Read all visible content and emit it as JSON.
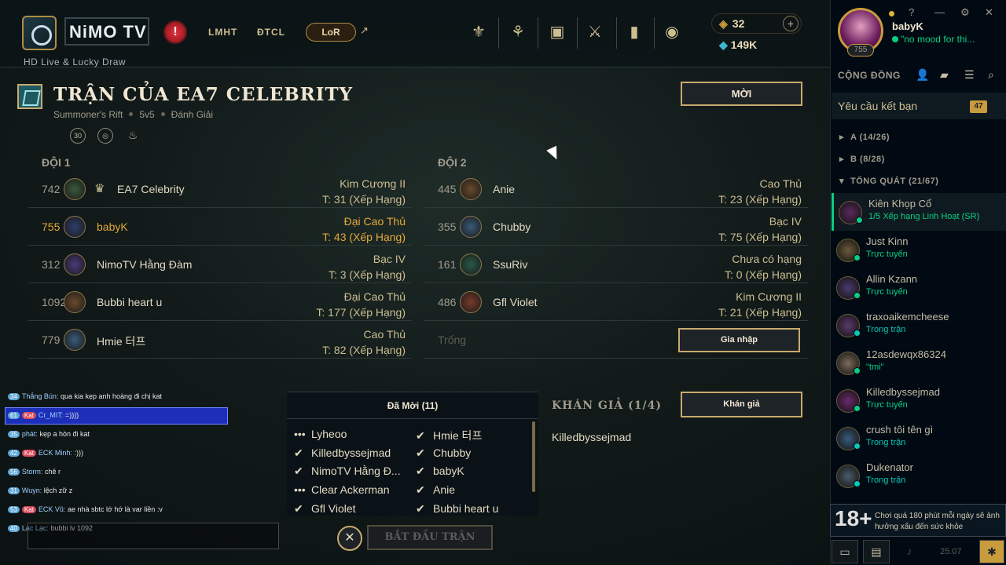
{
  "topbar": {
    "brand": "NiMO TV",
    "tagline": "HD Live & Lucky Draw",
    "nav": [
      "LMHT",
      "ĐTCL"
    ],
    "lor": "LoR",
    "rp": "32",
    "blue_essence": "149K",
    "icons": [
      "tft-icon",
      "loot-icon",
      "collection-icon",
      "clash-icon",
      "quests-icon",
      "store-icon"
    ]
  },
  "lobby": {
    "title": "TRẬN CỦA EA7 CELEBRITY",
    "map": "Summoner's Rift",
    "size": "5v5",
    "mode": "Đánh Giải",
    "mode_icon_label": "30",
    "invite_btn": "MỜI",
    "team1_title": "ĐỘI 1",
    "team2_title": "ĐỘI 2",
    "team1": [
      {
        "level": "742",
        "name": "EA7 Celebrity",
        "rank": "Kim Cương II",
        "tier": "T: 31 (Xếp Hạng)",
        "owner": true
      },
      {
        "level": "755",
        "name": "babyK",
        "rank": "Đại Cao Thủ",
        "tier": "T: 43 (Xếp Hạng)",
        "me": true
      },
      {
        "level": "312",
        "name": "NimoTV Hằng Đàm",
        "rank": "Bạc IV",
        "tier": "T: 3 (Xếp Hạng)"
      },
      {
        "level": "1092",
        "name": "Bubbi heart u",
        "rank": "Đại Cao Thủ",
        "tier": "T: 177 (Xếp Hạng)"
      },
      {
        "level": "779",
        "name": "Hmie 터프",
        "rank": "Cao Thủ",
        "tier": "T: 82 (Xếp Hạng)"
      }
    ],
    "team2": [
      {
        "level": "445",
        "name": "Anie",
        "rank": "Cao Thủ",
        "tier": "T: 23 (Xếp Hạng)"
      },
      {
        "level": "355",
        "name": "Chubby",
        "rank": "Bạc IV",
        "tier": "T: 75 (Xếp Hạng)"
      },
      {
        "level": "161",
        "name": "SsuRiv",
        "rank": "Chưa có hạng",
        "tier": "T: 0 (Xếp Hạng)"
      },
      {
        "level": "486",
        "name": "Gfl Violet",
        "rank": "Kim Cương II",
        "tier": "T: 21 (Xếp Hạng)"
      }
    ],
    "empty_slot": "Trống",
    "join_btn": "Gia nhập",
    "invited_title": "Đã Mời (11)",
    "invited": [
      {
        "name": "Lyheoo",
        "status": "•••"
      },
      {
        "name": "Hmie 터프",
        "status": "✔"
      },
      {
        "name": "Killedbyssejmad",
        "status": "✔"
      },
      {
        "name": "Chubby",
        "status": "✔"
      },
      {
        "name": "NimoTV Hằng Đ...",
        "status": "✔"
      },
      {
        "name": "babyK",
        "status": "✔"
      },
      {
        "name": "Clear Ackerman",
        "status": "•••"
      },
      {
        "name": "Anie",
        "status": "✔"
      },
      {
        "name": "Gfl Violet",
        "status": "✔"
      },
      {
        "name": "Bubbi heart u",
        "status": "✔"
      }
    ],
    "start_btn": "BẮT ĐẦU TRẬN",
    "cancel_icon": "✕",
    "spectators_title": "KHÁN GIẢ (1/4)",
    "spectate_btn": "Khán giả",
    "spectators": [
      "Killedbyssejmad"
    ]
  },
  "chat": [
    {
      "lv": "34",
      "user": "Thắng Bún:",
      "msg": "qua kia kẹp anh hoàng đi chị kat"
    },
    {
      "lv": "61",
      "user": "Cr_MIT:",
      "msg": "=))))",
      "tag": "Kat"
    },
    {
      "lv": "35",
      "user": "phát:",
      "msg": "kẹp a hòn đi kat"
    },
    {
      "lv": "42",
      "user": "ECK Minh:",
      "msg": ":)))",
      "tag": "Kat"
    },
    {
      "lv": "56",
      "user": "Storm:",
      "msg": "chê r"
    },
    {
      "lv": "31",
      "user": "Wuyn:",
      "msg": "lệch zữ z"
    },
    {
      "lv": "53",
      "user": "ECK Vũ:",
      "msg": "ae nhà sbtc lớ hớ là var liền :v",
      "tag": "Kat"
    },
    {
      "lv": "40",
      "user": "Lạc Lạc:",
      "msg": "bubbi lv 1092"
    }
  ],
  "social": {
    "profile_name": "babyK",
    "profile_level": "755",
    "profile_status": "\"no mood for thi...",
    "header": "CỘNG ĐỒNG",
    "friend_requests": "Yêu cầu kết bạn",
    "friend_requests_count": "47",
    "groups": [
      "A (14/26)",
      "B (8/28)",
      "TỔNG QUÁT (21/67)"
    ],
    "friends": [
      {
        "name": "Kiên Khọp Cổ",
        "status": "1/5 Xếp hạng Linh Hoạt (SR)"
      },
      {
        "name": "Just Kinn",
        "status": "Trực tuyến"
      },
      {
        "name": "Allin Kzann",
        "status": "Trực tuyến"
      },
      {
        "name": "traxoaikemcheese",
        "status": "Trong trận"
      },
      {
        "name": "12asdewqx86324",
        "status": "\"tmi\""
      },
      {
        "name": "Killedbyssejmad",
        "status": "Trực tuyến"
      },
      {
        "name": "crush tôi tên gì",
        "status": "Trong trận"
      },
      {
        "name": "Dukenator",
        "status": "Trong trận"
      }
    ],
    "age_rating": "18+",
    "age_warning": "Chơi quá 180 phút mỗi ngày sẽ ảnh hưởng xấu đến sức khỏe",
    "version": "25.07"
  },
  "colors": {
    "gold": "#c8aa6e",
    "online": "#0acf83",
    "ingame": "#0ac8b9",
    "me": "#e5a93a"
  }
}
